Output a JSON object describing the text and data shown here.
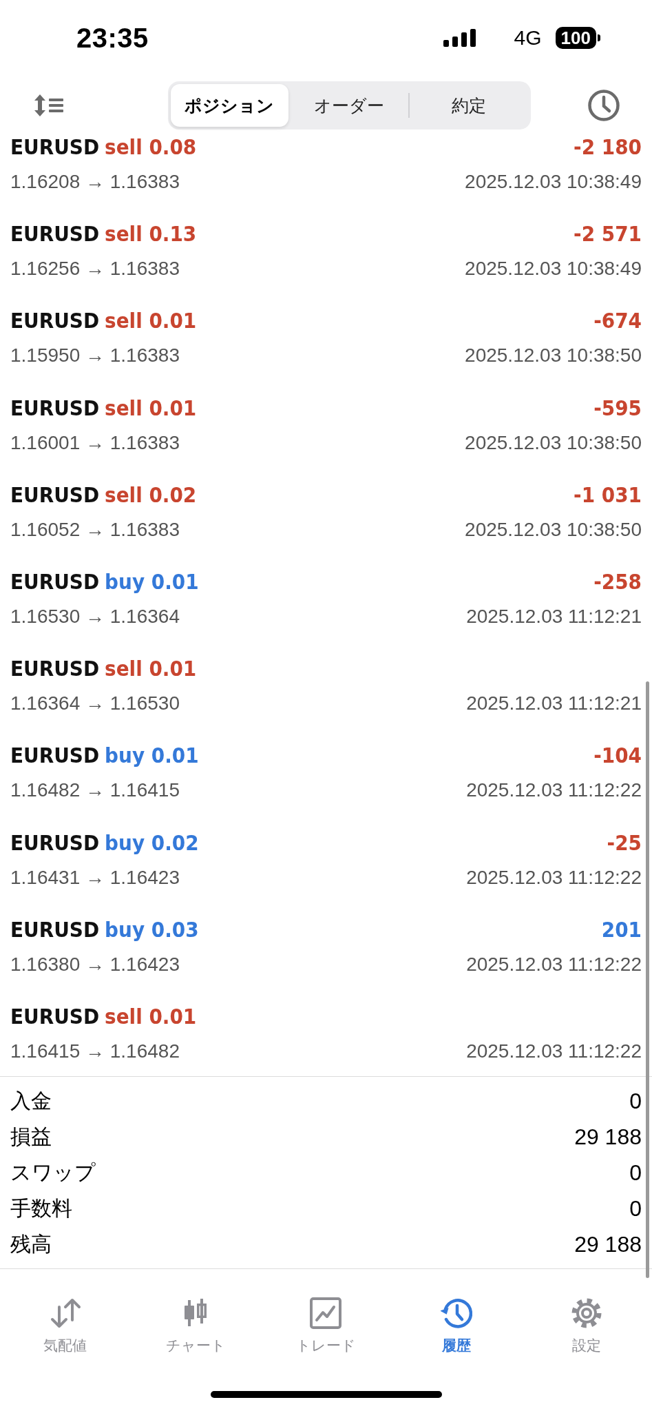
{
  "status_bar": {
    "time": "23:35",
    "network": "4G",
    "battery": "100"
  },
  "header": {
    "segments": [
      {
        "label": "ポジション",
        "selected": true
      },
      {
        "label": "オーダー",
        "selected": false
      },
      {
        "label": "約定",
        "selected": false
      }
    ]
  },
  "deals": [
    {
      "symbol": "EURUSD",
      "order": "sell 0.08",
      "kind": "sell",
      "profit": {
        "text": "-2 180",
        "kind": "loss"
      },
      "prices": "1.16208 → 1.16383",
      "time": "2025.12.03 10:38:49"
    },
    {
      "symbol": "EURUSD",
      "order": "sell 0.13",
      "kind": "sell",
      "profit": {
        "text": "-2 571",
        "kind": "loss"
      },
      "prices": "1.16256 → 1.16383",
      "time": "2025.12.03 10:38:49"
    },
    {
      "symbol": "EURUSD",
      "order": "sell 0.01",
      "kind": "sell",
      "profit": {
        "text": "-674",
        "kind": "loss"
      },
      "prices": "1.15950 → 1.16383",
      "time": "2025.12.03 10:38:50"
    },
    {
      "symbol": "EURUSD",
      "order": "sell 0.01",
      "kind": "sell",
      "profit": {
        "text": "-595",
        "kind": "loss"
      },
      "prices": "1.16001 → 1.16383",
      "time": "2025.12.03 10:38:50"
    },
    {
      "symbol": "EURUSD",
      "order": "sell 0.02",
      "kind": "sell",
      "profit": {
        "text": "-1 031",
        "kind": "loss"
      },
      "prices": "1.16052 → 1.16383",
      "time": "2025.12.03 10:38:50"
    },
    {
      "symbol": "EURUSD",
      "order": "buy 0.01",
      "kind": "buy",
      "profit": {
        "text": "-258",
        "kind": "loss"
      },
      "prices": "1.16530 → 1.16364",
      "time": "2025.12.03 11:12:21"
    },
    {
      "symbol": "EURUSD",
      "order": "sell 0.01",
      "kind": "sell",
      "prices": "1.16364 → 1.16530",
      "time": "2025.12.03 11:12:21"
    },
    {
      "symbol": "EURUSD",
      "order": "buy 0.01",
      "kind": "buy",
      "profit": {
        "text": "-104",
        "kind": "loss"
      },
      "prices": "1.16482 → 1.16415",
      "time": "2025.12.03 11:12:22"
    },
    {
      "symbol": "EURUSD",
      "order": "buy 0.02",
      "kind": "buy",
      "profit": {
        "text": "-25",
        "kind": "loss"
      },
      "prices": "1.16431 → 1.16423",
      "time": "2025.12.03 11:12:22"
    },
    {
      "symbol": "EURUSD",
      "order": "buy 0.03",
      "kind": "buy",
      "profit": {
        "text": "201",
        "kind": "gain"
      },
      "prices": "1.16380 → 1.16423",
      "time": "2025.12.03 11:12:22"
    },
    {
      "symbol": "EURUSD",
      "order": "sell 0.01",
      "kind": "sell",
      "prices": "1.16415 → 1.16482",
      "time": "2025.12.03 11:12:22"
    }
  ],
  "summary": [
    {
      "label": "入金",
      "value": "0"
    },
    {
      "label": "損益",
      "value": "29 188"
    },
    {
      "label": "スワップ",
      "value": "0"
    },
    {
      "label": "手数料",
      "value": "0"
    },
    {
      "label": "残高",
      "value": "29 188"
    }
  ],
  "tab_bar": {
    "items": [
      {
        "label": "気配値",
        "kind": "quotes",
        "selected": false
      },
      {
        "label": "チャート",
        "kind": "chart",
        "selected": false
      },
      {
        "label": "トレード",
        "kind": "trade",
        "selected": false
      },
      {
        "label": "履歴",
        "kind": "history",
        "selected": true
      },
      {
        "label": "設定",
        "kind": "settings",
        "selected": false
      }
    ]
  }
}
